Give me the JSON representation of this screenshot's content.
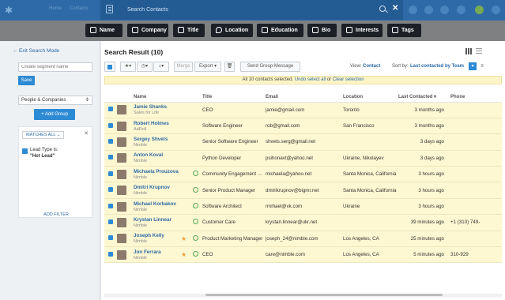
{
  "topbar": {
    "faded_left": "Home",
    "faded_contacts": "Contacts",
    "search_placeholder": "Search Contacts"
  },
  "chips": [
    {
      "label": "Name",
      "icon": "person-icon"
    },
    {
      "label": "Company",
      "icon": "building-icon"
    },
    {
      "label": "Title",
      "icon": "title-icon"
    },
    {
      "label": "Location",
      "icon": "pin-icon"
    },
    {
      "label": "Education",
      "icon": "cap-icon"
    },
    {
      "label": "Bio",
      "icon": "bio-icon"
    },
    {
      "label": "Interests",
      "icon": "home-icon"
    },
    {
      "label": "Tags",
      "icon": "tag-icon"
    }
  ],
  "sidebar": {
    "exit_label": "Exit Search Mode",
    "segment_placeholder": "Create segment name",
    "save_label": "Save",
    "entity_select": "People & Companies",
    "add_group_label": "+ Add Group",
    "matches_label": "MATCHES ALL",
    "filter_label": "Lead Type is:",
    "filter_value": "\"Hot Lead\"",
    "add_filter_label": "ADD FILTER"
  },
  "main": {
    "title": "Search Result (10)",
    "toolbar": {
      "merge": "Merge",
      "export": "Export",
      "send_group": "Send Group Message",
      "view_label": "View:",
      "view_value": "Contact",
      "sort_label": "Sort by:",
      "sort_value": "Last contacted by Team"
    },
    "banner": {
      "text": "All 10 contacts selected.",
      "undo": "Undo select all",
      "or": "or",
      "clear": "Clear selection"
    },
    "columns": [
      "Name",
      "Title",
      "Email",
      "Location",
      "Last Contacted",
      "Phone"
    ],
    "rows": [
      {
        "name": "Jamie Shanks",
        "company": "Sales for Life",
        "title": "CEO",
        "email": "jamie@gmail.com",
        "location": "Toronto",
        "last": "3 months ago",
        "phone": "",
        "star": false,
        "clock": false
      },
      {
        "name": "Robert Holmes",
        "company": "AdRoll",
        "title": "Software Engineer",
        "email": "rob@gmail.com",
        "location": "San Francisco",
        "last": "3 months ago",
        "phone": "",
        "star": false,
        "clock": false
      },
      {
        "name": "Sergey Shvets",
        "company": "Nimble",
        "title": "Senior Software Engineer",
        "email": "shvets.serg@gmail.net",
        "location": "",
        "last": "3 days ago",
        "phone": "",
        "star": false,
        "clock": false
      },
      {
        "name": "Anton Koval",
        "company": "Nimble",
        "title": "Python Developer",
        "email": "psihonavt@yahoo.net",
        "location": "Ukraine, Nikolayev",
        "last": "3 days ago",
        "phone": "",
        "star": false,
        "clock": false
      },
      {
        "name": "Michaela Prouzova",
        "company": "Nimble",
        "title": "Community Engagement Manager",
        "email": "michaela@yahoo.net",
        "location": "Santa Monica, California",
        "last": "3 hours ago",
        "phone": "",
        "star": false,
        "clock": true
      },
      {
        "name": "Dmitri Krupnov",
        "company": "Nimble",
        "title": "Senior Product Manager",
        "email": "dmtrikrupnov@bigmr.net",
        "location": "Santa Monica, California",
        "last": "3 hours ago",
        "phone": "",
        "star": false,
        "clock": true
      },
      {
        "name": "Michael Korbakov",
        "company": "Nimble",
        "title": "Software Architect",
        "email": "rmihael@vk.com",
        "location": "Ukraine",
        "last": "3 hours ago",
        "phone": "",
        "star": false,
        "clock": true
      },
      {
        "name": "Krystan Linnear",
        "company": "Nimble",
        "title": "Customer Care",
        "email": "krystan.linnear@ukr.net",
        "location": "",
        "last": "39 minutes ago",
        "phone": "+1 (310) 749-",
        "star": false,
        "clock": true
      },
      {
        "name": "Joseph Kelly",
        "company": "Nimble",
        "title": "Product Marketing Manager",
        "email": "joseph_24@nimble.com",
        "location": "Los Angeles, CA",
        "last": "25 minutes ago",
        "phone": "",
        "star": true,
        "clock": true
      },
      {
        "name": "Jon Ferrara",
        "company": "Nimble",
        "title": "CEO",
        "email": "care@nimble.com",
        "location": "Los Angeles, CA",
        "last": "5 minutes ago",
        "phone": "310-929",
        "star": true,
        "clock": true
      }
    ]
  },
  "colors": {
    "accent": "#2d6aa7",
    "button": "#2d8ad4",
    "highlight": "#fdf7d2",
    "star": "#f0a23a"
  }
}
